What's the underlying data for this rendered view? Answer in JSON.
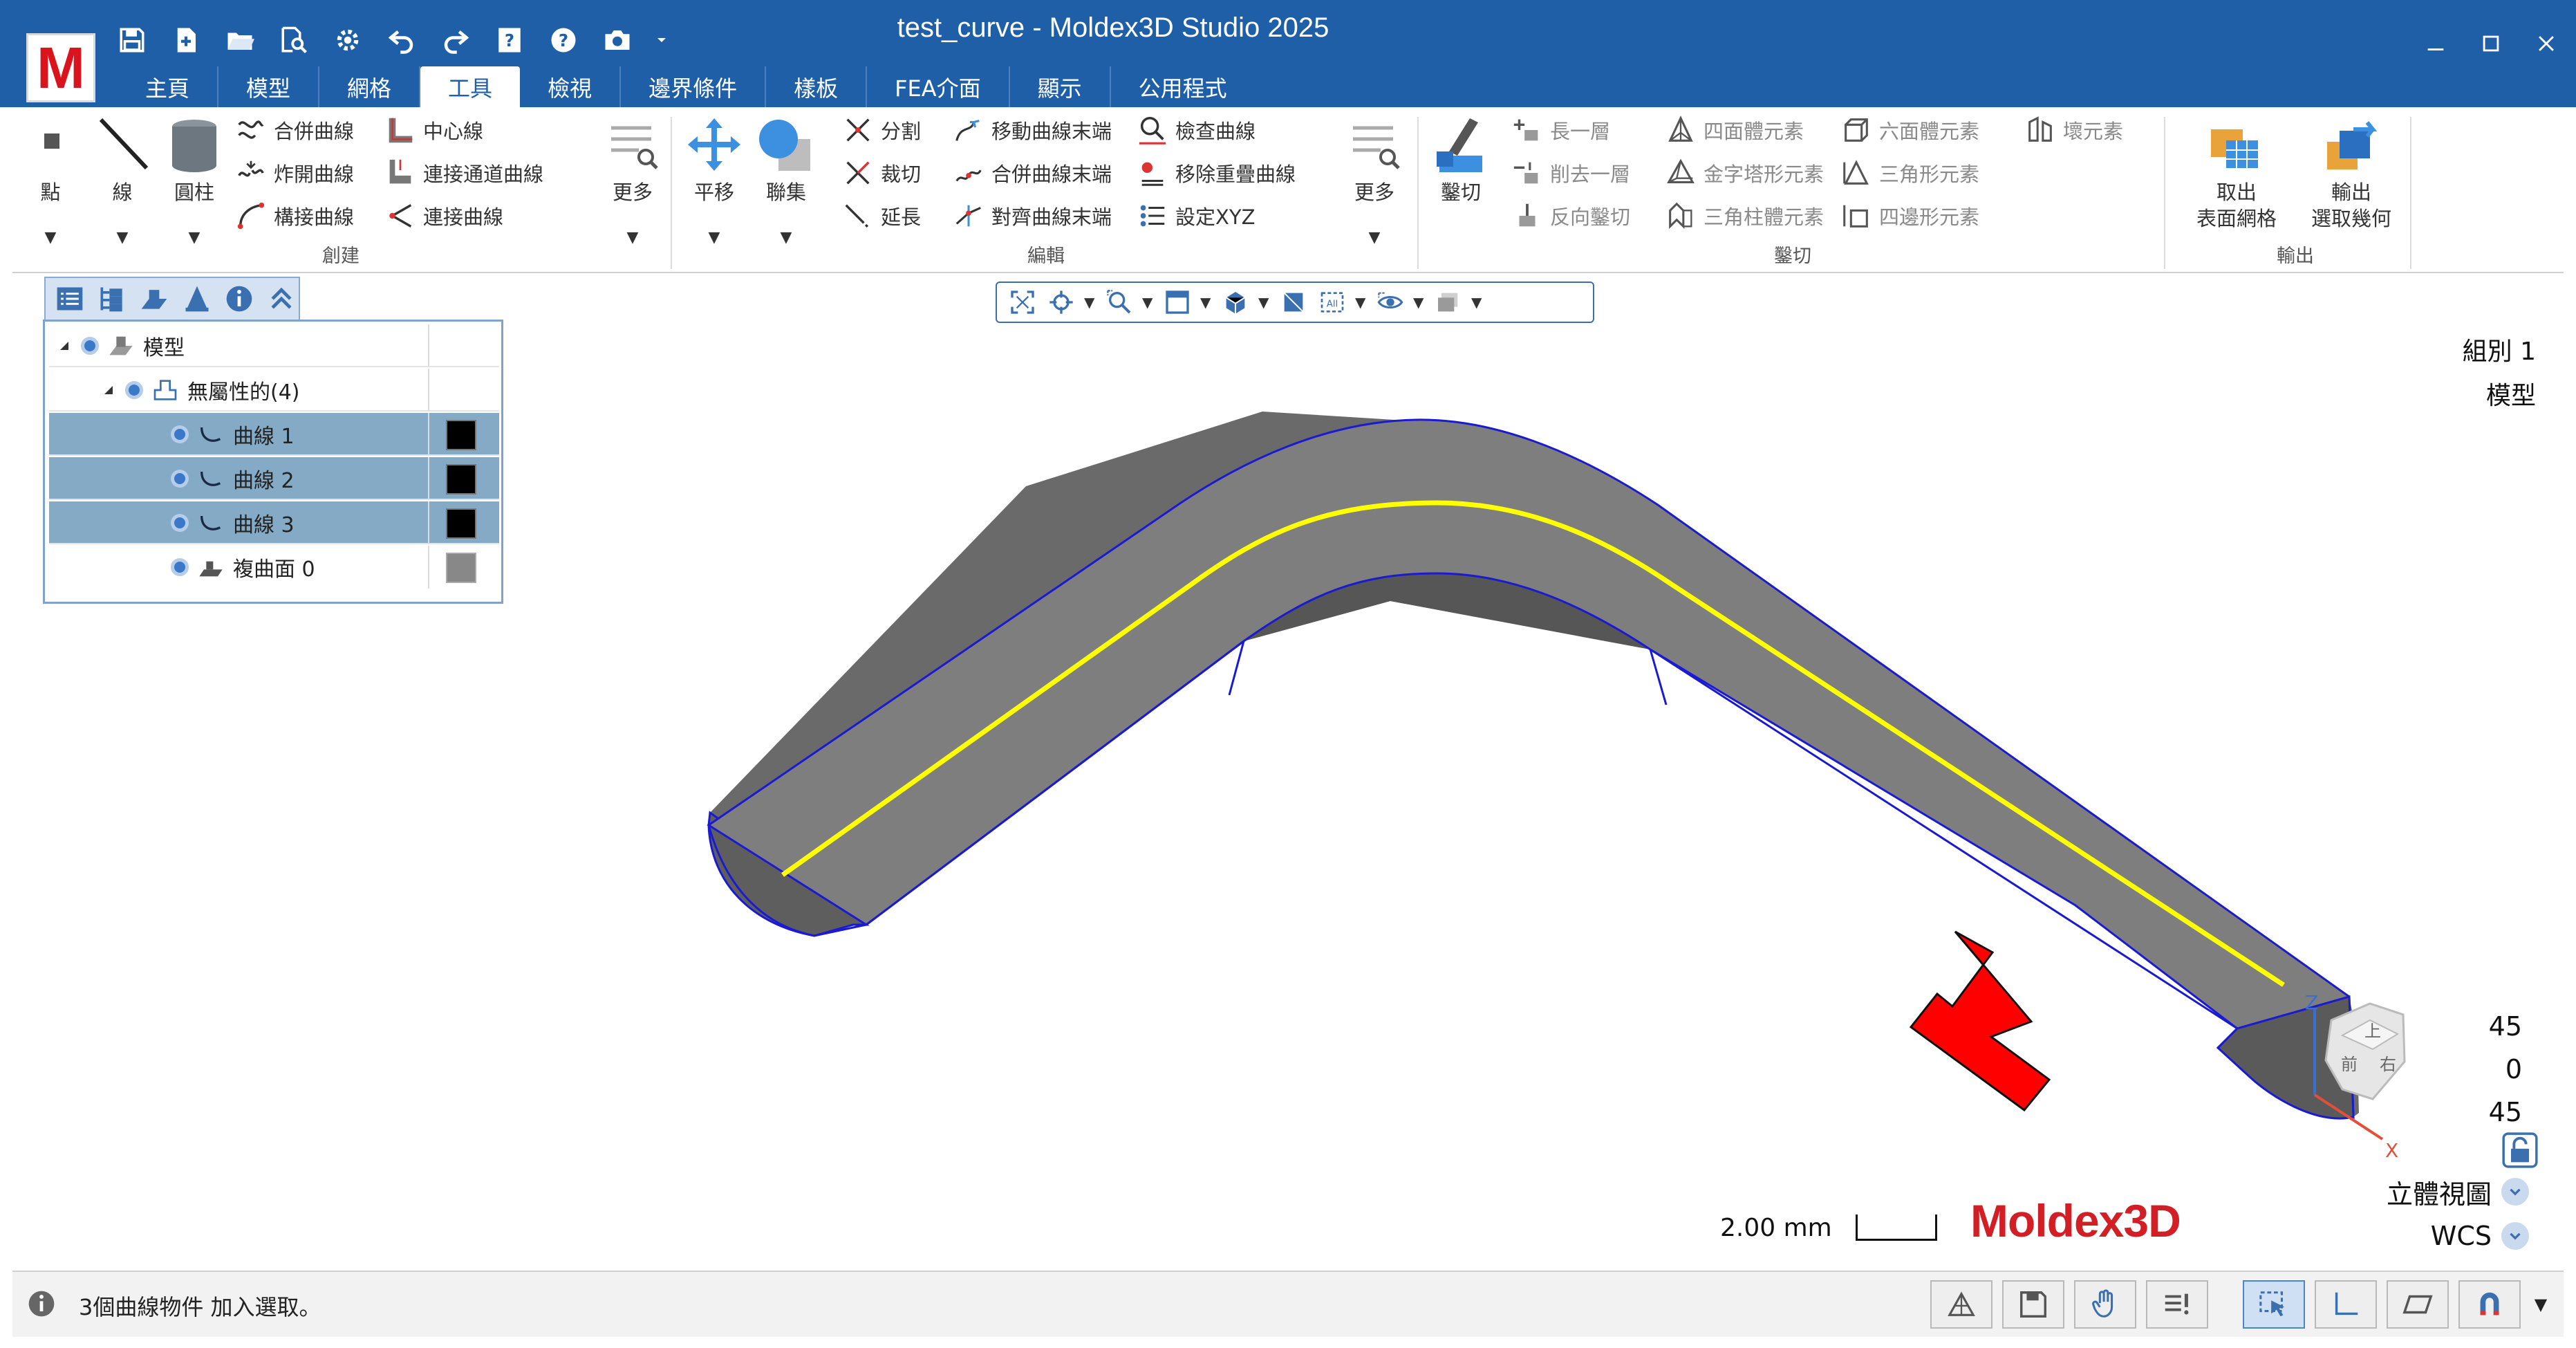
{
  "window": {
    "title": "test_curve - Moldex3D Studio 2025",
    "logo_letter": "M",
    "brand_color": "#1f5fa8",
    "accent_color": "#d9141c"
  },
  "quick_access": [
    "save-icon",
    "new-icon",
    "open-folder-icon",
    "find-icon",
    "settings-icon",
    "undo-icon",
    "redo-icon",
    "help-book-icon",
    "help-icon",
    "camera-icon"
  ],
  "tabs": [
    "主頁",
    "模型",
    "網格",
    "工具",
    "檢視",
    "邊界條件",
    "樣板",
    "FEA介面",
    "顯示",
    "公用程式"
  ],
  "active_tab": "工具",
  "ribbon": {
    "create": {
      "label": "創建",
      "point": "點",
      "line": "線",
      "cylinder": "圓柱",
      "merge_curve": "合併曲線",
      "explode_curve": "炸開曲線",
      "build_curve": "構接曲線",
      "center_line": "中心線",
      "connect_channel_curve": "連接通道曲線",
      "connect_curve": "連接曲線",
      "more": "更多"
    },
    "edit": {
      "label": "編輯",
      "translate": "平移",
      "gather": "聯集",
      "split": "分割",
      "trim": "裁切",
      "extend": "延長",
      "move_curve_end": "移動曲線末端",
      "merge_curve_end": "合併曲線末端",
      "align_curve_end": "對齊曲線末端",
      "check_curve": "檢查曲線",
      "remove_overlap_curve": "移除重疊曲線",
      "set_xyz": "設定XYZ",
      "more": "更多"
    },
    "cut": {
      "label": "鑿切",
      "cut": "鑿切",
      "grow_layer": "長一層",
      "peel_layer": "削去一層",
      "reverse_cut": "反向鑿切",
      "tetra": "四面體元素",
      "pyramid": "金字塔形元素",
      "prism": "三角柱體元素",
      "hexa": "六面體元素",
      "triangle": "三角形元素",
      "quad": "四邊形元素",
      "bad_element": "壞元素"
    },
    "output": {
      "label": "輸出",
      "extract_surface_mesh": "取出\n表面網格",
      "export_geometry": "輸出\n選取幾何"
    }
  },
  "view_toolbar": [
    "fit-icon",
    "center-icon",
    "zoom-icon",
    "window-icon",
    "cube-icon",
    "plane-icon",
    "select-all-icon",
    "eye-icon",
    "display-icon"
  ],
  "panel": {
    "tab_icons": [
      "list-icon",
      "tree-icon",
      "layer-icon",
      "cone-icon",
      "info-icon",
      "collapse-icon"
    ],
    "rows": [
      {
        "label": "模型",
        "indent": 0,
        "selected": false,
        "swatch": ""
      },
      {
        "label": "無屬性的(4)",
        "indent": 1,
        "selected": false,
        "swatch": ""
      },
      {
        "label": "曲線 1",
        "indent": 2,
        "selected": true,
        "swatch": "#000000"
      },
      {
        "label": "曲線 2",
        "indent": 2,
        "selected": true,
        "swatch": "#000000"
      },
      {
        "label": "曲線 3",
        "indent": 2,
        "selected": true,
        "swatch": "#000000"
      },
      {
        "label": "複曲面 0",
        "indent": 2,
        "selected": false,
        "swatch": "#888888"
      }
    ]
  },
  "viewport": {
    "group_label": "組別 1",
    "model_label": "模型",
    "angles": [
      "45",
      "0",
      "45"
    ],
    "view_mode": "立體視圖",
    "coord_system": "WCS",
    "scale_text": "2.00 mm",
    "brand": "Moldex3D",
    "cube_faces": {
      "top": "上",
      "front": "前",
      "right": "右"
    },
    "axes": {
      "z": "Z",
      "x": "X"
    },
    "model_color": "#808080",
    "curve_color": "#ffff00",
    "edge_color": "#1a1ad0",
    "arrow_color": "#ff0000"
  },
  "status": {
    "text": "3個曲線物件 加入選取。"
  },
  "status_tools": [
    "mesh-icon",
    "save-icon",
    "hand-icon",
    "list-icon",
    "select-icon",
    "axis-icon",
    "plane-icon",
    "magnet-icon"
  ]
}
